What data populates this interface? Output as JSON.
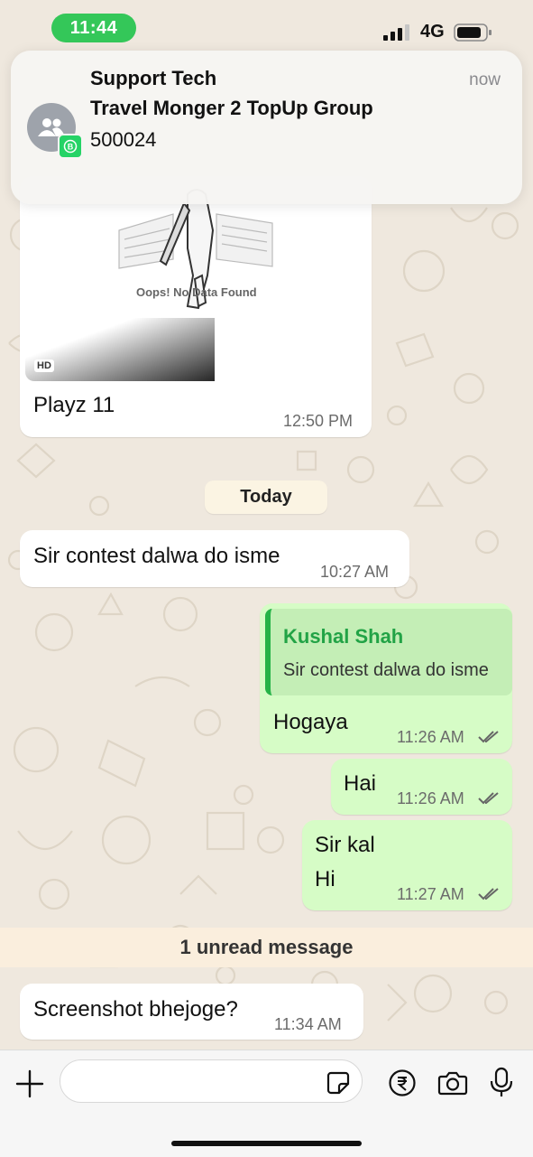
{
  "status_bar": {
    "time": "11:44",
    "network": "4G"
  },
  "notification": {
    "title": "Support Tech",
    "subtitle": "Travel Monger 2 TopUp Group",
    "body": "500024",
    "time": "now"
  },
  "chat": {
    "image_message": {
      "image_caption_text": "Oops! No Data Found",
      "hd_label": "HD",
      "text": "Playz 11",
      "time": "12:50 PM"
    },
    "date_chip": "Today",
    "messages": [
      {
        "direction": "in",
        "text": "Sir contest dalwa do isme",
        "time": "10:27 AM"
      },
      {
        "direction": "out",
        "reply_author": "Kushal Shah",
        "reply_text": "Sir contest dalwa do isme",
        "text": "Hogaya",
        "time": "11:26 AM"
      },
      {
        "direction": "out",
        "text": "Hai",
        "time": "11:26 AM"
      },
      {
        "direction": "out",
        "lines": [
          "Sir kal",
          "Hi"
        ],
        "time": "11:27 AM"
      }
    ],
    "unread_banner": "1 unread message",
    "last_message": {
      "direction": "in",
      "text": "Screenshot bhejoge?",
      "time": "11:34 AM"
    }
  },
  "input_bar": {
    "placeholder": "",
    "icons": [
      "plus-icon",
      "sticker-icon",
      "rupee-icon",
      "camera-icon",
      "mic-icon"
    ]
  },
  "colors": {
    "outgoing_bubble": "#d6fcc6",
    "incoming_bubble": "#ffffff",
    "accent_green": "#25d366",
    "status_pill": "#34c759",
    "wallpaper": "#efe8de"
  }
}
